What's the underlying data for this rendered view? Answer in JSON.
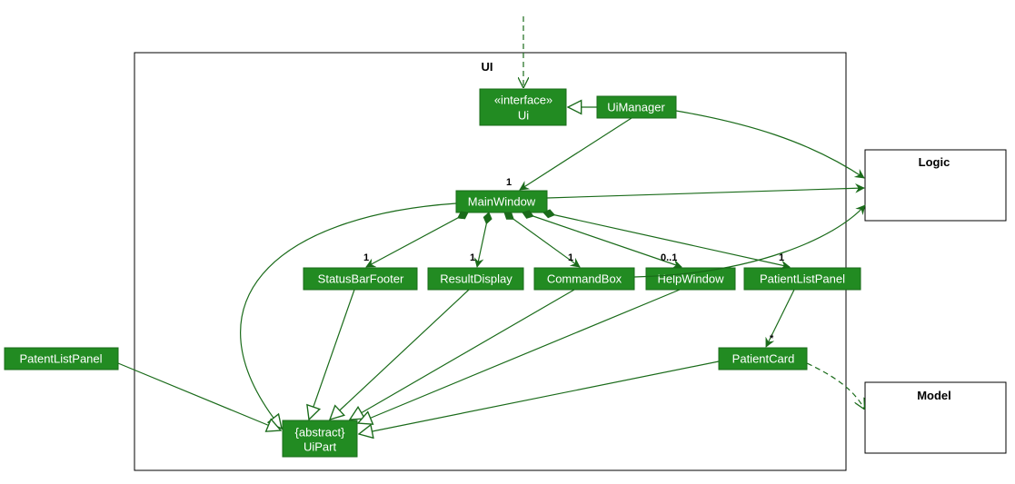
{
  "package": {
    "label": "UI"
  },
  "nodes": {
    "ui": {
      "stereotype": "«interface»",
      "name": "Ui"
    },
    "uimanager": {
      "name": "UiManager"
    },
    "mainwindow": {
      "name": "MainWindow"
    },
    "statusbarfooter": {
      "name": "StatusBarFooter"
    },
    "resultdisplay": {
      "name": "ResultDisplay"
    },
    "commandbox": {
      "name": "CommandBox"
    },
    "helpwindow": {
      "name": "HelpWindow"
    },
    "patientlistpanel": {
      "name": "PatientListPanel"
    },
    "patientcard": {
      "name": "PatientCard"
    },
    "uipart": {
      "stereotype": "{abstract}",
      "name": "UiPart"
    },
    "patentlistpanel": {
      "name": "PatentListPanel"
    },
    "logic": {
      "name": "Logic"
    },
    "model": {
      "name": "Model"
    }
  },
  "multiplicities": {
    "mainwindow": "1",
    "statusbarfooter": "1",
    "resultdisplay": "1",
    "commandbox": "1",
    "helpwindow": "0..1",
    "patientlistpanel": "1",
    "patientcard": "*"
  }
}
